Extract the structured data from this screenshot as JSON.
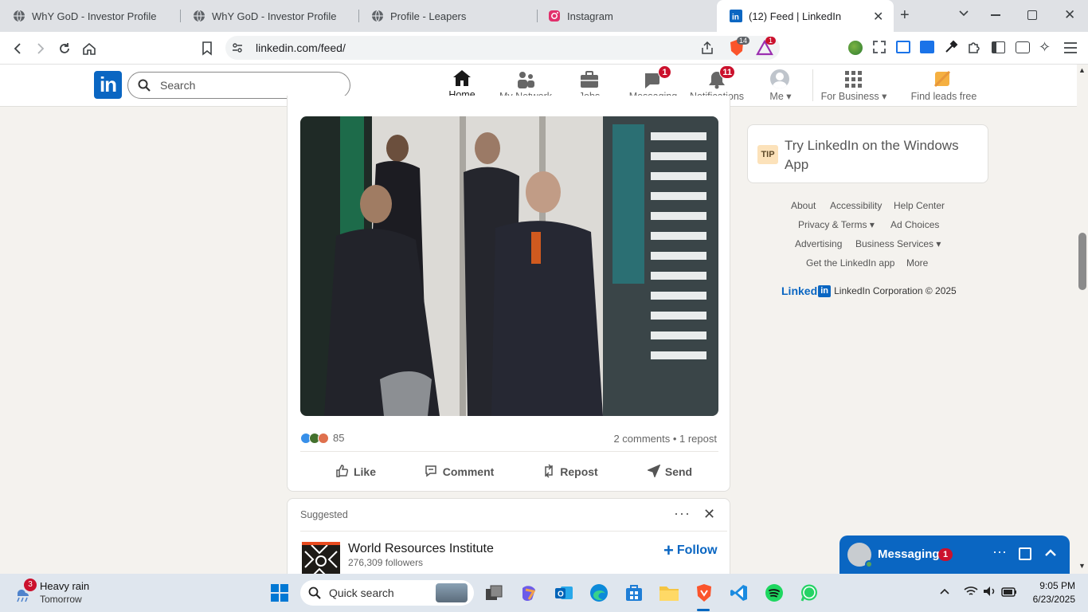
{
  "browser": {
    "tabs": [
      {
        "title": "WhY GoD - Investor Profile",
        "active": false
      },
      {
        "title": "WhY GoD - Investor Profile",
        "active": false
      },
      {
        "title": "Profile - Leapers",
        "active": false
      },
      {
        "title": "Instagram",
        "active": false
      },
      {
        "title": "(12) Feed | LinkedIn",
        "active": true
      }
    ],
    "url": "linkedin.com/feed/",
    "brave_shield_count": "14",
    "rewards_count": "1"
  },
  "linkedin": {
    "search_placeholder": "Search",
    "nav": {
      "home": "Home",
      "network": "My Network",
      "jobs": "Jobs",
      "messaging": "Messaging",
      "messaging_badge": "1",
      "notifications": "Notifications",
      "notifications_badge": "11",
      "me": "Me",
      "business": "For Business",
      "leads": "Find leads free"
    },
    "post": {
      "reaction_count": "85",
      "comments_reposts": "2 comments • 1 repost",
      "actions": {
        "like": "Like",
        "comment": "Comment",
        "repost": "Repost",
        "send": "Send"
      }
    },
    "suggested": {
      "label": "Suggested",
      "org_name": "World Resources Institute",
      "followers": "276,309 followers",
      "follow_label": "Follow"
    },
    "sidebar": {
      "tip_badge": "TIP",
      "tip_text": "Try LinkedIn on the Windows App",
      "links": {
        "about": "About",
        "accessibility": "Accessibility",
        "help": "Help Center",
        "privacy": "Privacy & Terms",
        "adchoices": "Ad Choices",
        "advertising": "Advertising",
        "business_services": "Business Services",
        "get_app": "Get the LinkedIn app",
        "more": "More"
      },
      "copyright": "LinkedIn Corporation © 2025"
    },
    "messaging_widget": {
      "label": "Messaging",
      "badge": "1"
    }
  },
  "taskbar": {
    "weather_badge": "3",
    "weather_title": "Heavy rain",
    "weather_sub": "Tomorrow",
    "search_label": "Quick search",
    "time": "9:05 PM",
    "date": "6/23/2025"
  },
  "colors": {
    "linkedin_blue": "#0a66c2",
    "badge_red": "#cb112d"
  }
}
